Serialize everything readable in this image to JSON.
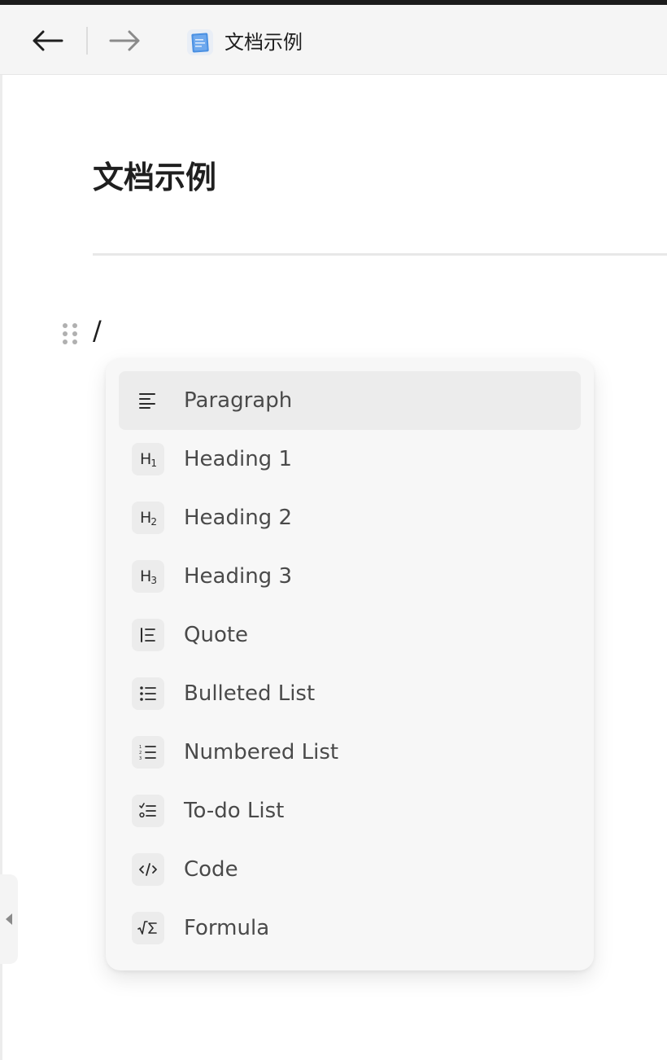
{
  "toolbar": {
    "document_title": "文档示例",
    "back_icon": "arrow-left-icon",
    "forward_icon": "arrow-right-icon",
    "doc_icon": "document-icon"
  },
  "page": {
    "title": "文档示例",
    "editor_text": "/"
  },
  "menu": {
    "items": [
      {
        "label": "Paragraph",
        "icon": "paragraph-icon"
      },
      {
        "label": "Heading 1",
        "icon": "heading-1-icon"
      },
      {
        "label": "Heading 2",
        "icon": "heading-2-icon"
      },
      {
        "label": "Heading 3",
        "icon": "heading-3-icon"
      },
      {
        "label": "Quote",
        "icon": "quote-icon"
      },
      {
        "label": "Bulleted List",
        "icon": "bulleted-list-icon"
      },
      {
        "label": "Numbered List",
        "icon": "numbered-list-icon"
      },
      {
        "label": "To-do List",
        "icon": "todo-list-icon"
      },
      {
        "label": "Code",
        "icon": "code-icon"
      },
      {
        "label": "Formula",
        "icon": "formula-icon"
      }
    ],
    "active_index": 0
  },
  "colors": {
    "menu_background": "#f7f7f7",
    "active_item": "#ececec",
    "label_text": "#4a4a4a",
    "doc_icon_blue": "#4a90e2"
  }
}
